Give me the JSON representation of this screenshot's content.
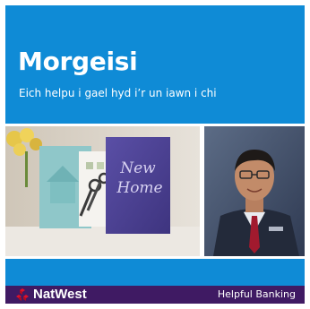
{
  "header": {
    "title": "Morgeisi",
    "subtitle": "Eich helpu i gael hyd i’r un iawn i chi"
  },
  "images": {
    "left": {
      "card_text": "New Home"
    }
  },
  "footer": {
    "brand": "NatWest",
    "tagline": "Helpful Banking"
  },
  "colors": {
    "background": "#0f8bd6",
    "footer": "#3f1a63",
    "logo": "#e1102a"
  }
}
